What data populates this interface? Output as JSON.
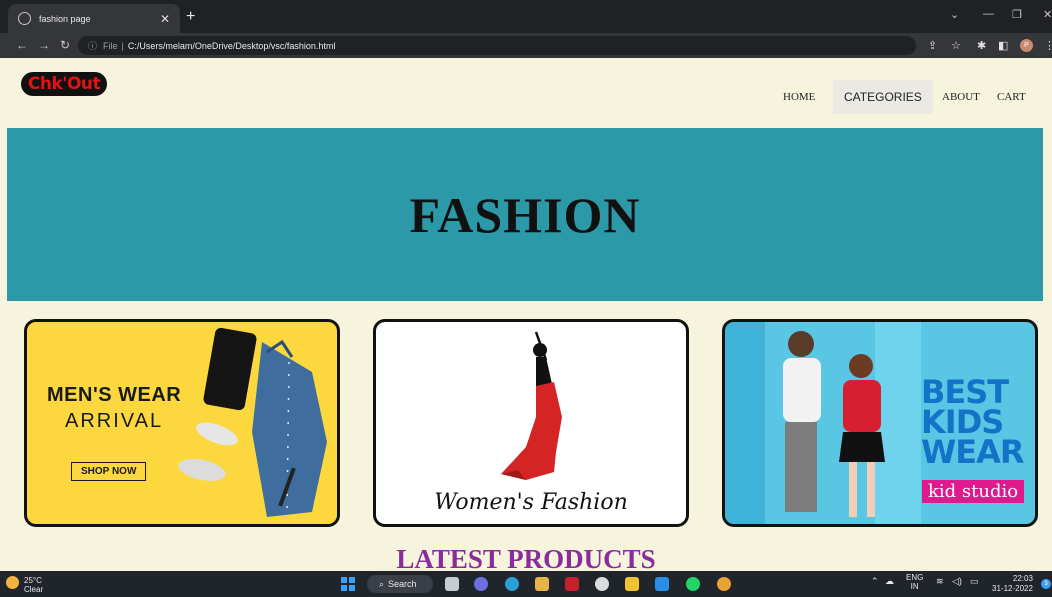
{
  "browser": {
    "tab_title": "fashion page",
    "url_prefix": "File",
    "url": "C:/Users/melam/OneDrive/Desktop/vsc/fashion.html",
    "profile_initial": "P"
  },
  "site": {
    "logo_text_a": "Chk'",
    "logo_text_b": "Out",
    "nav": [
      "HOME",
      "CATEGORIES",
      "ABOUT",
      "CART"
    ],
    "hero_title": "FASHION",
    "cards": [
      {
        "title": "MEN'S WEAR",
        "subtitle": "ARRIVAL",
        "button": "SHOP NOW"
      },
      {
        "label": "Women's Fashion"
      },
      {
        "line1": "BEST",
        "line2": "KIDS",
        "line3": "WEAR",
        "brand": "kid studio"
      }
    ],
    "section_title": "LATEST PRODUCTS"
  },
  "taskbar": {
    "temp": "25°C",
    "weather": "Clear",
    "search": "Search",
    "lang1": "ENG",
    "lang2": "IN",
    "time": "22:03",
    "date": "31-12-2022",
    "notif_count": "3"
  }
}
